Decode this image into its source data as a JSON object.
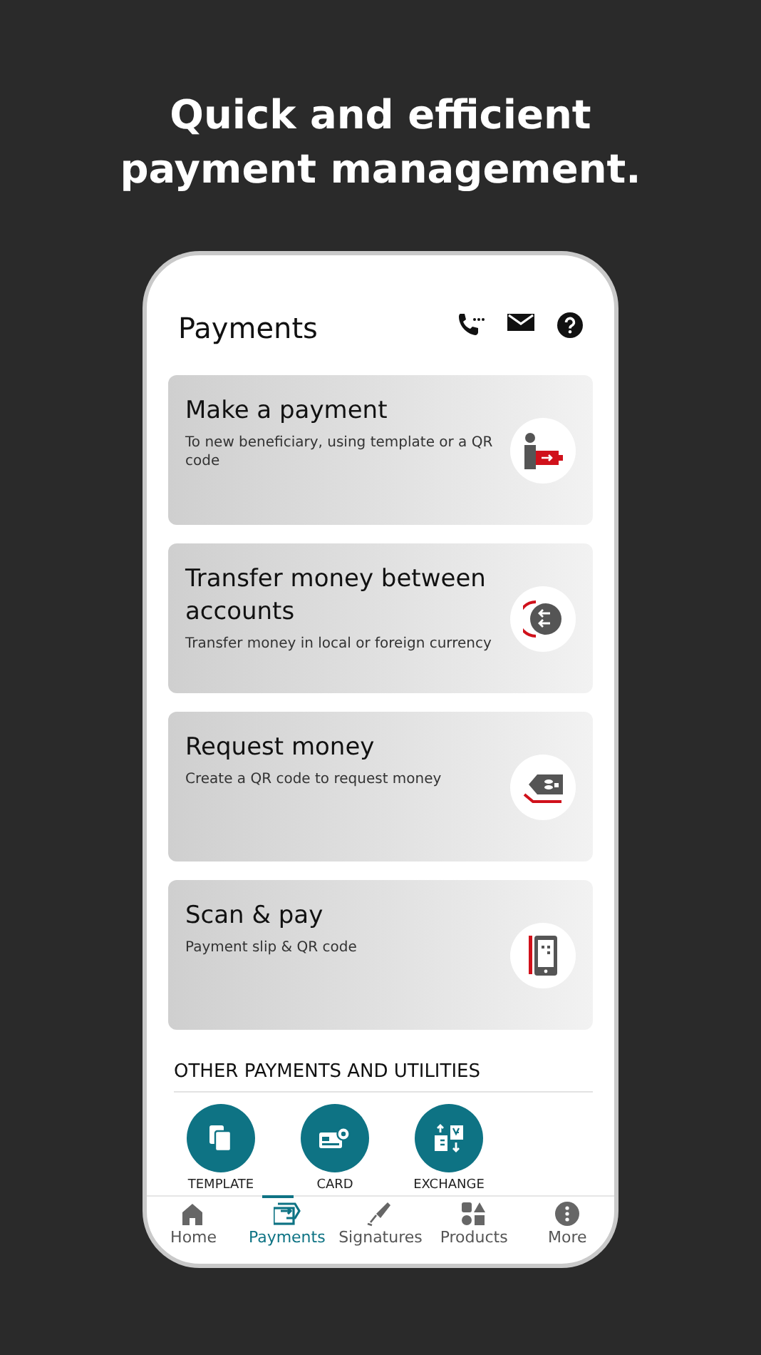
{
  "headline": "Quick and efficient payment management.",
  "screen": {
    "title": "Payments"
  },
  "actions": [
    {
      "title": "Make a payment",
      "subtitle": "To new beneficiary, using template or a QR code",
      "kind": "person"
    },
    {
      "title": "Transfer money between accounts",
      "subtitle": "Transfer money in local or foreign currency",
      "kind": "transfer"
    },
    {
      "title": "Request money",
      "subtitle": "Create a QR code to request money",
      "kind": "request"
    },
    {
      "title": "Scan & pay",
      "subtitle": "Payment slip & QR code",
      "kind": "scan"
    }
  ],
  "section_title": "OTHER PAYMENTS AND UTILITIES",
  "utilities": [
    {
      "label": "TEMPLATE",
      "kind": "template"
    },
    {
      "label": "CARD",
      "kind": "card"
    },
    {
      "label": "EXCHANGE",
      "kind": "exchange"
    }
  ],
  "nav": [
    {
      "label": "Home",
      "kind": "home",
      "selected": false
    },
    {
      "label": "Payments",
      "kind": "payments",
      "selected": true
    },
    {
      "label": "Signatures",
      "kind": "signatures",
      "selected": false
    },
    {
      "label": "Products",
      "kind": "products",
      "selected": false
    },
    {
      "label": "More",
      "kind": "more",
      "selected": false
    }
  ]
}
